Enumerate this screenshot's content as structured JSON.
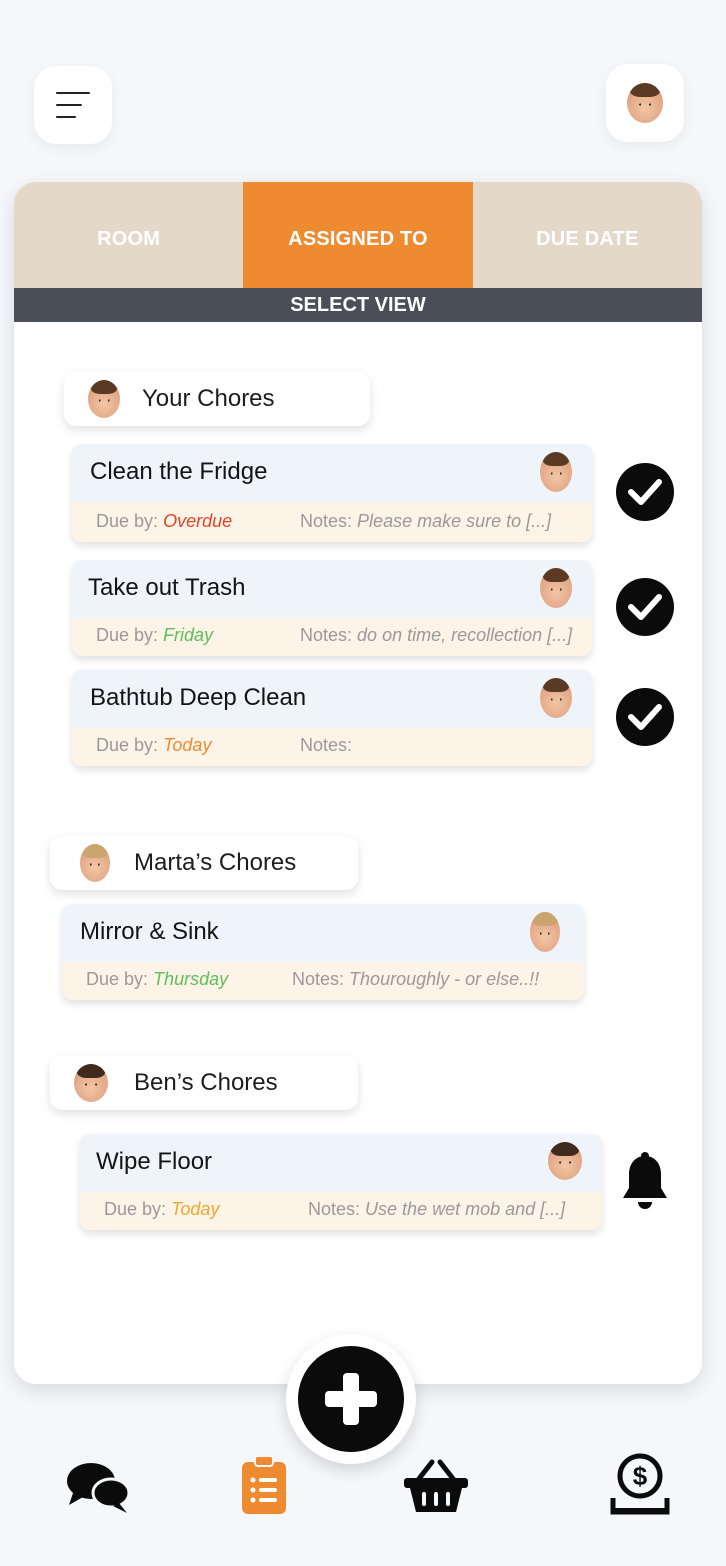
{
  "header": {
    "menu_icon": "hamburger-menu-icon",
    "profile_icon": "user-avatar"
  },
  "tabs": [
    {
      "label": "ROOM",
      "active": false
    },
    {
      "label": "ASSIGNED TO",
      "active": true
    },
    {
      "label": "DUE DATE",
      "active": false
    }
  ],
  "select_view_label": "SELECT VIEW",
  "groups": [
    {
      "title": "Your Chores",
      "chores": [
        {
          "title": "Clean the Fridge",
          "due_label": "Due by:",
          "due_value": "Overdue",
          "due_color": "#e0452b",
          "notes_label": "Notes:",
          "notes_value": "Please make sure to [...]",
          "action": "check"
        },
        {
          "title": "Take out Trash",
          "due_label": "Due by:",
          "due_value": "Friday",
          "due_color": "#5cbf5a",
          "notes_label": "Notes:",
          "notes_value": "do on time, recollection [...]",
          "action": "check"
        },
        {
          "title": "Bathtub Deep Clean",
          "due_label": "Due by:",
          "due_value": "Today",
          "due_color": "#ee8b30",
          "notes_label": "Notes:",
          "notes_value": "",
          "action": "check"
        }
      ]
    },
    {
      "title": "Marta’s Chores",
      "chores": [
        {
          "title": "Mirror & Sink",
          "due_label": "Due by:",
          "due_value": "Thursday",
          "due_color": "#5cbf5a",
          "notes_label": "Notes:",
          "notes_value": "Thouroughly - or else..!!",
          "action": "none"
        }
      ]
    },
    {
      "title": "Ben’s Chores",
      "chores": [
        {
          "title": "Wipe Floor",
          "due_label": "Due by:",
          "due_value": "Today",
          "due_color": "#f0a830",
          "notes_label": "Notes:",
          "notes_value": "Use the wet mob and [...]",
          "action": "bell"
        }
      ]
    }
  ],
  "colors": {
    "accent": "#ee8b30",
    "tab_bg": "#e4d8c8",
    "select_bar": "#4a4e57",
    "card_bottom": "#fdf3e6",
    "card_top": "#eff4fb"
  },
  "bottom_nav": [
    {
      "icon": "chat-bubbles-icon",
      "active": false
    },
    {
      "icon": "clipboard-list-icon",
      "active": true
    },
    {
      "icon": "shopping-basket-icon",
      "active": false
    },
    {
      "icon": "money-deposit-icon",
      "active": false
    }
  ],
  "fab_icon": "plus-icon"
}
